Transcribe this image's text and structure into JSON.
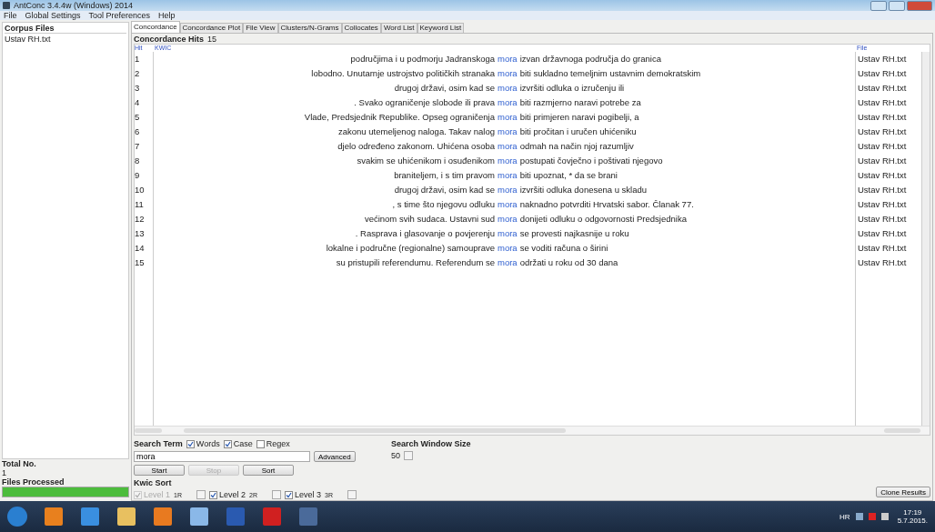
{
  "window": {
    "title": "AntConc 3.4.4w (Windows) 2014"
  },
  "menu": [
    "File",
    "Global Settings",
    "Tool Preferences",
    "Help"
  ],
  "corpus_files": {
    "title": "Corpus Files",
    "files": [
      {
        "name": "Ustav RH.txt",
        "selected": false
      }
    ]
  },
  "total_no": {
    "label": "Total No.",
    "value": "1"
  },
  "files_processed": {
    "label": "Files Processed",
    "level": 1
  },
  "tabs": [
    {
      "label": "Concordance",
      "selected": true
    },
    {
      "label": "Concordance Plot",
      "selected": false
    },
    {
      "label": "File View",
      "selected": false
    },
    {
      "label": "Clusters/N-Grams",
      "selected": false
    },
    {
      "label": "Collocates",
      "selected": false
    },
    {
      "label": "Word List",
      "selected": false
    },
    {
      "label": "Keyword List",
      "selected": false
    }
  ],
  "concordance_hits": {
    "label": "Concordance Hits",
    "value": "15"
  },
  "table": {
    "columns": [
      "Hit",
      "KWIC",
      "File"
    ],
    "rows": [
      {
        "hit": "1",
        "left": "područjima i u podmorju Jadranskoga",
        "keyword": "mora",
        "right": "izvan državnoga područja do granica",
        "file": "Ustav RH.txt"
      },
      {
        "hit": "2",
        "left": "lobodno. Unutarnje ustrojstvo političkih stranaka",
        "keyword": "mora",
        "right": "biti sukladno temeljnim ustavnim demokratskim",
        "file": "Ustav RH.txt"
      },
      {
        "hit": "3",
        "left": "drugoj državi, osim kad se",
        "keyword": "mora",
        "right": "izvršiti odluka o izručenju ili",
        "file": "Ustav RH.txt"
      },
      {
        "hit": "4",
        "left": ". Svako ograničenje slobode ili prava",
        "keyword": "mora",
        "right": "biti razmjerno naravi potrebe za",
        "file": "Ustav RH.txt"
      },
      {
        "hit": "5",
        "left": "Vlade, Predsjednik Republike. Opseg ograničenja",
        "keyword": "mora",
        "right": "biti primjeren naravi pogibelji, a",
        "file": "Ustav RH.txt"
      },
      {
        "hit": "6",
        "left": "zakonu utemeljenog naloga. Takav nalog",
        "keyword": "mora",
        "right": "biti pročitan i uručen uhićeniku",
        "file": "Ustav RH.txt"
      },
      {
        "hit": "7",
        "left": "djelo određeno zakonom. Uhićena osoba",
        "keyword": "mora",
        "right": "odmah na način njoj razumljiv",
        "file": "Ustav RH.txt"
      },
      {
        "hit": "8",
        "left": "svakim se uhićenikom i osuđenikom",
        "keyword": "mora",
        "right": "postupati čovječno i poštivati njegovo",
        "file": "Ustav RH.txt"
      },
      {
        "hit": "9",
        "left": "braniteljem, i s tim pravom",
        "keyword": "mora",
        "right": "biti upoznat, * da se brani",
        "file": "Ustav RH.txt"
      },
      {
        "hit": "10",
        "left": "drugoj državi, osim kad se",
        "keyword": "mora",
        "right": "izvršiti odluka donesena u skladu",
        "file": "Ustav RH.txt"
      },
      {
        "hit": "11",
        "left": ", s time što njegovu odluku",
        "keyword": "mora",
        "right": "naknadno potvrditi Hrvatski sabor. Članak 77.",
        "file": "Ustav RH.txt"
      },
      {
        "hit": "12",
        "left": "većinom svih sudaca. Ustavni sud",
        "keyword": "mora",
        "right": "donijeti odluku o odgovornosti Predsjednika",
        "file": "Ustav RH.txt"
      },
      {
        "hit": "13",
        "left": ". Rasprava i glasovanje o povjerenju",
        "keyword": "mora",
        "right": "se provesti najkasnije u roku",
        "file": "Ustav RH.txt"
      },
      {
        "hit": "14",
        "left": "lokalne i područne (regionalne) samouprave",
        "keyword": "mora",
        "right": "se voditi računa o širini",
        "file": "Ustav RH.txt"
      },
      {
        "hit": "15",
        "left": "su pristupili referendumu. Referendum se",
        "keyword": "mora",
        "right": "održati u roku od 30 dana",
        "file": "Ustav RH.txt"
      }
    ]
  },
  "search": {
    "label": "Search Term",
    "options": [
      {
        "label": "Words",
        "checked": true
      },
      {
        "label": "Case",
        "checked": true
      },
      {
        "label": "Regex",
        "checked": false
      }
    ],
    "value": "mora",
    "advanced": "Advanced"
  },
  "search_window_size": {
    "label": "Search Window Size",
    "value": "50"
  },
  "buttons": [
    {
      "label": "Start",
      "disabled": false
    },
    {
      "label": "Stop",
      "disabled": true
    },
    {
      "label": "Sort",
      "disabled": false
    }
  ],
  "kwic_sort": {
    "label": "Kwic Sort",
    "levels": [
      {
        "label": "Level 1",
        "value": "1R",
        "checked": true,
        "disabled": true
      },
      {
        "label": "Level 2",
        "value": "2R",
        "checked": true,
        "disabled": false
      },
      {
        "label": "Level 3",
        "value": "3R",
        "checked": true,
        "disabled": false
      }
    ]
  },
  "clone_results": "Clone Results",
  "taskbar": {
    "language": "HR",
    "time": "17:19",
    "date": "5.7.2015."
  }
}
